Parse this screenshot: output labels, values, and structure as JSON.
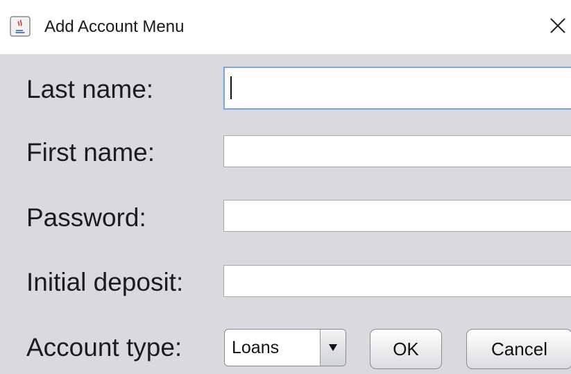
{
  "window": {
    "title": "Add Account Menu",
    "icon": "java-cup-icon",
    "close_glyph": "✕"
  },
  "form": {
    "last_name_label": "Last name:",
    "last_name_value": "",
    "first_name_label": "First name:",
    "first_name_value": "",
    "password_label": "Password:",
    "password_value": "",
    "initial_deposit_label": "Initial deposit:",
    "initial_deposit_value": "",
    "account_type_label": "Account type:",
    "account_type_selected": "Loans",
    "ok_label": "OK",
    "cancel_label": "Cancel"
  },
  "colors": {
    "background": "#d9d9df",
    "focus_border": "#7ea6d6",
    "title_bar": "#ffffff"
  }
}
